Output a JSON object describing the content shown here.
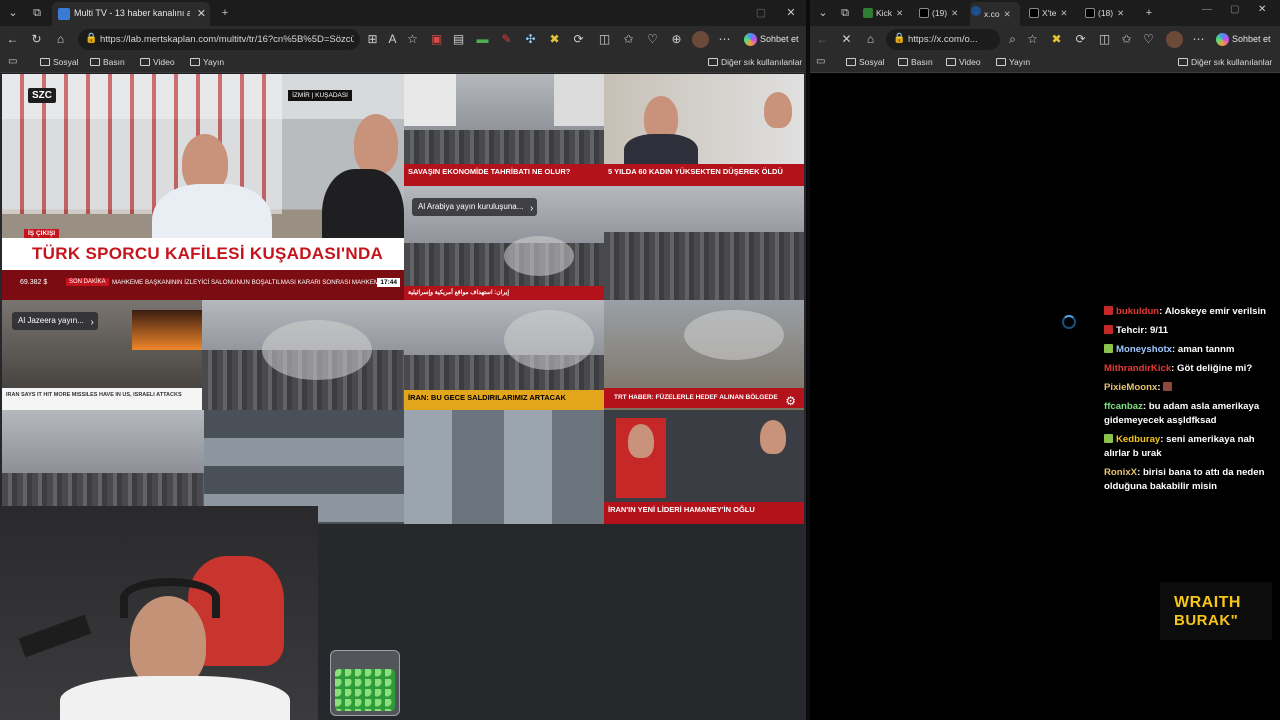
{
  "left_browser": {
    "tab_title": "Multi TV - 13 haber kanalını aynı a",
    "url": "https://lab.mertskaplan.com/multitv/tr/16?cn%5B%5D=Sözcü...",
    "chat_button": "Sohbet et",
    "bookmarks": [
      "Sosyal",
      "Basın",
      "Video",
      "Yayın"
    ],
    "other_bookmarks": "Diğer sık kullanılanlar"
  },
  "right_browser": {
    "tabs": [
      {
        "label": "Kick",
        "color": "#2e7d32"
      },
      {
        "label": "(19)",
        "color": "#111111"
      },
      {
        "label": "x.co",
        "color": "#1d4f8a"
      },
      {
        "label": "X'te",
        "color": "#111111"
      },
      {
        "label": "(18)",
        "color": "#111111"
      }
    ],
    "url": "https://x.com/o...",
    "chat_button": "Sohbet et",
    "bookmarks": [
      "Sosyal",
      "Basın",
      "Video",
      "Yayın"
    ],
    "other_bookmarks": "Diğer sık kullanılanlar"
  },
  "tv_grid": {
    "main": {
      "channel_logo": "SZC",
      "location": "İZMİR | KUŞADASI",
      "tag": "İŞ ÇIKIŞI",
      "headline": "TÜRK SPORCU KAFİLESİ KUŞADASI'NDA",
      "ticker_value": "69.382 $",
      "ticker_tag": "SON DAKİKA",
      "ticker_text": "MAHKEME BAŞKANININ İZLEYİCİ SALONUNUN BOŞALTILMASI KARARI SONRASI MAHKEM",
      "time": "17:44"
    },
    "cell2_headline": "SAVAŞIN EKONOMİDE TAHRİBATI NE OLUR?",
    "cell3_headline": "5 YILDA 60 KADIN YÜKSEKTEN DÜŞEREK ÖLDÜ",
    "aa_overlay": "Al Arabiya yayın kuruluşuna...",
    "alarabiya_ticker": "إيران: استهداف مواقع أمريكية وإسرائيلية",
    "aj_overlay": "Al Jazeera yayın...",
    "aj_ticker": "IRAN SAYS IT HIT MORE MISSILES HAVE IN US, ISRAELI ATTACKS",
    "orange_headline": "İRAN: BU GECE SALDIRILARIMIZ ARTACAK",
    "trt_headline": "TRT HABER: FÜZELERLE HEDEF ALINAN BÖLGEDE",
    "halk_headline": "İRAN'IN YENİ LİDERİ HAMANEY'İN OĞLU"
  },
  "chat_messages": [
    {
      "user": "bukuldun",
      "text": "Aloskeye emir verilsin",
      "color": "#e53935",
      "icon": "#c62828"
    },
    {
      "user": "Tehcir",
      "text": "9/11",
      "color": "#ffffff",
      "icon": "#c62828"
    },
    {
      "user": "Moneyshotx",
      "text": "aman tannm",
      "color": "#9ec8ff",
      "icon": "#8bc34a"
    },
    {
      "user": "MithrandirKick",
      "text": "Göt deliğine mi?",
      "color": "#e53935",
      "icon": ""
    },
    {
      "user": "PixieMoonx",
      "text": "",
      "color": "#e6c46e",
      "icon": ""
    },
    {
      "user": "ffcanbaz",
      "text": "bu adam asla amerikaya gidemeyecek asşldfksad",
      "color": "#7ee081",
      "icon": ""
    },
    {
      "user": "Kedburay",
      "text": "seni amerikaya nah alırlar b urak",
      "color": "#f5c518",
      "icon": "#8bc34a"
    },
    {
      "user": "RonixX",
      "text": "birisi bana to attı da neden olduğuna bakabilir misin",
      "color": "#e6c46e",
      "icon": ""
    }
  ],
  "overlay_brand": {
    "line1": "WRAITH",
    "line2": "BURAK\""
  }
}
